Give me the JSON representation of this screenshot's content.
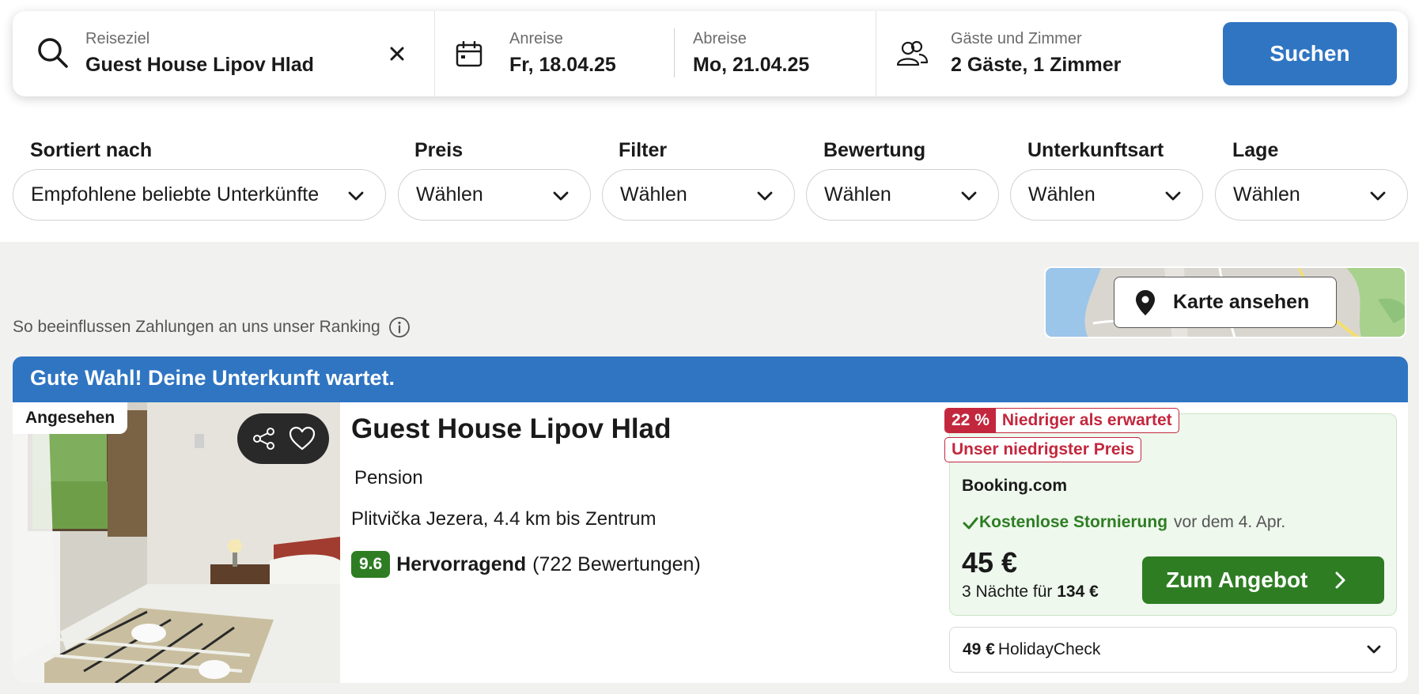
{
  "search": {
    "destination_label": "Reiseziel",
    "destination_value": "Guest House Lipov Hlad",
    "checkin_label": "Anreise",
    "checkin_value": "Fr, 18.04.25",
    "checkout_label": "Abreise",
    "checkout_value": "Mo, 21.04.25",
    "guests_label": "Gäste und Zimmer",
    "guests_value": "2 Gäste, 1 Zimmer",
    "search_button": "Suchen",
    "icons": [
      "search-icon",
      "clear-icon",
      "calendar-icon",
      "guests-icon"
    ]
  },
  "filters": [
    {
      "label": "Sortiert nach",
      "value": "Empfohlene beliebte Unterkünfte"
    },
    {
      "label": "Preis",
      "value": "Wählen"
    },
    {
      "label": "Filter",
      "value": "Wählen"
    },
    {
      "label": "Bewertung",
      "value": "Wählen"
    },
    {
      "label": "Unterkunftsart",
      "value": "Wählen"
    },
    {
      "label": "Lage",
      "value": "Wählen"
    }
  ],
  "ranking_note": "So beeinflussen Zahlungen an uns unser Ranking",
  "map_button": "Karte ansehen",
  "result": {
    "banner": "Gute Wahl! Deine Unterkunft wartet.",
    "seen_badge": "Angesehen",
    "name": "Guest House Lipov Hlad",
    "type": "Pension",
    "location": "Plitvička Jezera, 4.4 km bis Zentrum",
    "rating_score": "9.6",
    "rating_text": "Hervorragend",
    "rating_count": "(722 Bewertungen)",
    "discount_percent": "22 %",
    "discount_text": "Niedriger als erwartet",
    "lowest_price_tag": "Unser niedrigster Preis",
    "provider": "Booking.com",
    "cancel_bold": "Kostenlose Stornierung",
    "cancel_note": "vor dem 4. Apr.",
    "price": "45 €",
    "price_sub_prefix": "3 Nächte für",
    "price_total": "134 €",
    "offer_button": "Zum Angebot",
    "alt_price": "49 €",
    "alt_provider": "HolidayCheck"
  },
  "colors": {
    "brand_blue": "#2f75c2",
    "deal_green": "#2e7d23",
    "discount_red": "#c3273d"
  }
}
